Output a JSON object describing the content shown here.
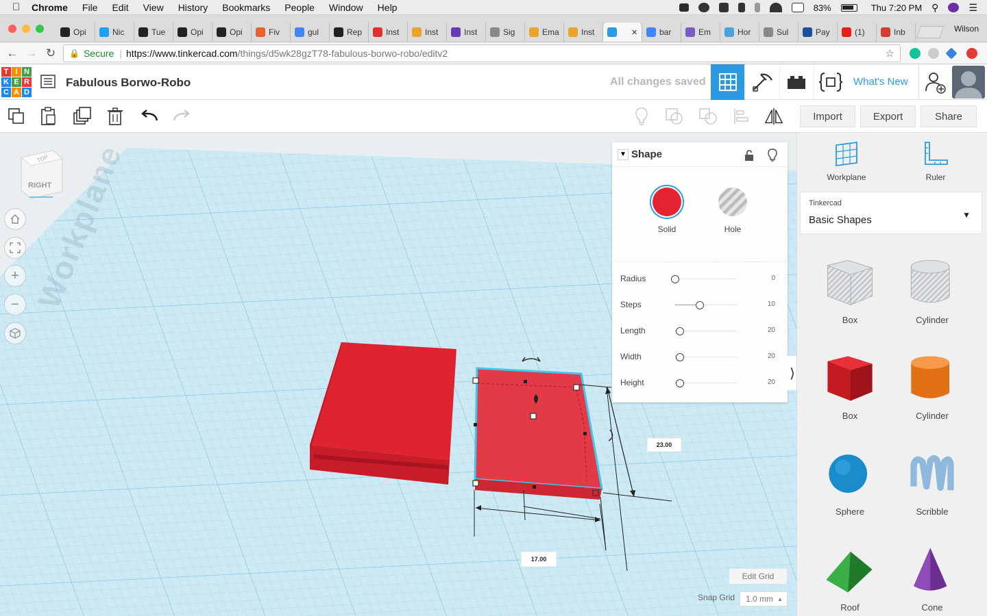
{
  "mac_menubar": {
    "app": "Chrome",
    "menus": [
      "File",
      "Edit",
      "View",
      "History",
      "Bookmarks",
      "People",
      "Window",
      "Help"
    ],
    "battery": "83%",
    "clock": "Thu 7:20 PM"
  },
  "browser": {
    "tabs": [
      {
        "label": "Opi",
        "icon": "nyt-icon",
        "color": "#222222"
      },
      {
        "label": "Nic",
        "icon": "twitter-icon",
        "color": "#1da1f2"
      },
      {
        "label": "Tue",
        "icon": "nyt-icon",
        "color": "#222222"
      },
      {
        "label": "Opi",
        "icon": "nyt-icon",
        "color": "#222222"
      },
      {
        "label": "Opi",
        "icon": "nyt-icon",
        "color": "#222222"
      },
      {
        "label": "Fiv",
        "icon": "fivethirtyeight-icon",
        "color": "#e8622c"
      },
      {
        "label": "gul",
        "icon": "google-icon",
        "color": "#4285f4"
      },
      {
        "label": "Rep",
        "icon": "nyt-icon",
        "color": "#222222"
      },
      {
        "label": "Inst",
        "icon": "lifesaver-icon",
        "color": "#e03030"
      },
      {
        "label": "Inst",
        "icon": "instructor-icon",
        "color": "#e8a42c"
      },
      {
        "label": "Inst",
        "icon": "form-icon",
        "color": "#673ab7"
      },
      {
        "label": "Sig",
        "icon": "doc-icon",
        "color": "#888888"
      },
      {
        "label": "Ema",
        "icon": "instructor-icon",
        "color": "#e8a42c"
      },
      {
        "label": "Inst",
        "icon": "instructor-icon",
        "color": "#e8a42c"
      },
      {
        "label": "",
        "icon": "tinkercad-icon",
        "color": "#2b9ae0"
      },
      {
        "label": "bar",
        "icon": "google-icon",
        "color": "#4285f4"
      },
      {
        "label": "Em",
        "icon": "barcode-icon",
        "color": "#7a5cc4"
      },
      {
        "label": "Hor",
        "icon": "cloud-icon",
        "color": "#4aa3df"
      },
      {
        "label": "Sul",
        "icon": "doc-icon",
        "color": "#888888"
      },
      {
        "label": "Pay",
        "icon": "pay-icon",
        "color": "#1a4fa0"
      },
      {
        "label": "(1)",
        "icon": "youtube-icon",
        "color": "#e62117"
      },
      {
        "label": "Inb",
        "icon": "gmail-icon",
        "color": "#d23f31"
      }
    ],
    "profile_name": "Wilson",
    "secure_label": "Secure",
    "url_host": "https://www.tinkercad.com",
    "url_path": "/things/d5wk28gzT78-fabulous-borwo-robo/editv2"
  },
  "tinkercad": {
    "logo_letters": [
      "T",
      "I",
      "N",
      "K",
      "E",
      "R",
      "C",
      "A",
      "D"
    ],
    "logo_colors": [
      "#e53935",
      "#fb8c00",
      "#43a047",
      "#1e88e5",
      "#43a047",
      "#e53935",
      "#1e88e5",
      "#fb8c00",
      "#1e88e5"
    ],
    "design_title": "Fabulous Borwo-Robo",
    "save_status": "All changes saved",
    "whats_new": "What's New",
    "toolbar_buttons": {
      "import": "Import",
      "export": "Export",
      "share": "Share"
    },
    "viewcube_face": "RIGHT",
    "workplane_watermark": "Workplane",
    "shape_panel": {
      "title": "Shape",
      "solid_label": "Solid",
      "hole_label": "Hole",
      "solid_color": "#e3232f",
      "params": [
        {
          "label": "Radius",
          "value": "0",
          "fraction": 0
        },
        {
          "label": "Steps",
          "value": "10",
          "fraction": 0.4
        },
        {
          "label": "Length",
          "value": "20",
          "fraction": 0.08
        },
        {
          "label": "Width",
          "value": "20",
          "fraction": 0.08
        },
        {
          "label": "Height",
          "value": "20",
          "fraction": 0.08
        }
      ]
    },
    "dimensions": {
      "height_mm": "23.00",
      "length_mm": "17.00"
    },
    "edit_grid": "Edit Grid",
    "snap_grid_label": "Snap Grid",
    "snap_grid_value": "1.0 mm",
    "sidebar": {
      "workplane": "Workplane",
      "ruler": "Ruler",
      "library_category": "Tinkercad",
      "library_name": "Basic Shapes",
      "shapes": [
        {
          "label": "Box",
          "icon": "box-hole-icon"
        },
        {
          "label": "Cylinder",
          "icon": "cylinder-hole-icon"
        },
        {
          "label": "Box",
          "icon": "box-icon",
          "color": "#d81f26"
        },
        {
          "label": "Cylinder",
          "icon": "cylinder-icon",
          "color": "#ef7d1a"
        },
        {
          "label": "Sphere",
          "icon": "sphere-icon",
          "color": "#1990d0"
        },
        {
          "label": "Scribble",
          "icon": "scribble-icon",
          "color": "#8fb8dd"
        },
        {
          "label": "Roof",
          "icon": "roof-icon",
          "color": "#2e9b3a"
        },
        {
          "label": "Cone",
          "icon": "cone-icon",
          "color": "#7b3fa0"
        }
      ]
    }
  }
}
